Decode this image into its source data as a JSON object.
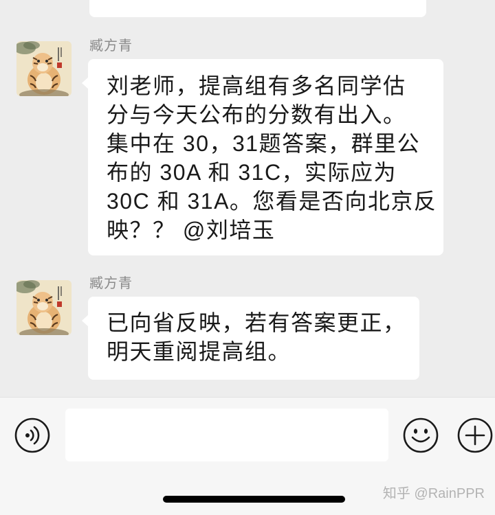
{
  "chat": {
    "messages": [
      {
        "sender": "臧方青",
        "lines": [
          "刘老师，提高组有多名同学估",
          "分与今天公布的分数有出入。",
          "集中在 30，31题答案，群里公",
          "布的 30A 和 31C，实际应为",
          "30C 和 31A。您看是否向北京反",
          "映？？ @刘培玉"
        ]
      },
      {
        "sender": "臧方青",
        "lines": [
          "已向省反映，若有答案更正，",
          "明天重阅提高组。"
        ]
      }
    ]
  },
  "input_bar": {
    "voice_icon": "voice-icon",
    "input_value": "",
    "emoji_icon": "emoji-icon",
    "plus_icon": "plus-icon"
  },
  "watermark": "知乎 @RainPPR",
  "colors": {
    "chat_background": "#ededed",
    "bubble": "#ffffff",
    "sender_name": "#8a8a8a",
    "message_text": "#191919",
    "input_bar_background": "#f6f6f6"
  }
}
